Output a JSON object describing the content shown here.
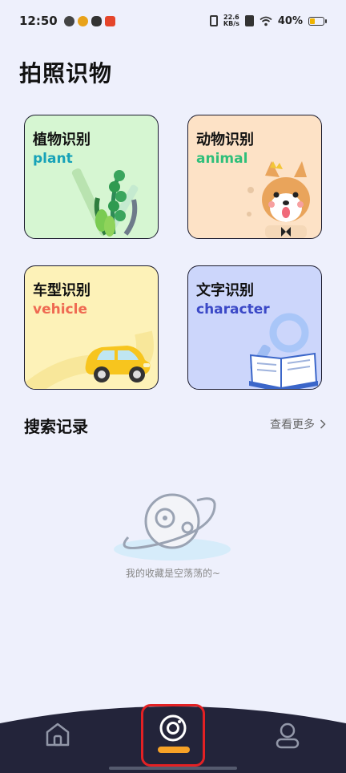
{
  "status_bar": {
    "time": "12:50",
    "net_speed_value": "22.6",
    "net_speed_unit": "KB/s",
    "battery": "40%",
    "battery_level": 0.4
  },
  "page_title": "拍照识物",
  "cards": [
    {
      "zh": "植物识别",
      "en": "plant",
      "en_color": "#17a2b8"
    },
    {
      "zh": "动物识别",
      "en": "animal",
      "en_color": "#2fbf7a"
    },
    {
      "zh": "车型识别",
      "en": "vehicle",
      "en_color": "#ef6a52"
    },
    {
      "zh": "文字识别",
      "en": "character",
      "en_color": "#3b49c7"
    }
  ],
  "history": {
    "title": "搜索记录",
    "more": "查看更多",
    "empty_text": "我的收藏是空荡荡的~"
  },
  "tabs": [
    {
      "name": "home",
      "icon": "home-icon"
    },
    {
      "name": "camera",
      "icon": "camera-icon",
      "active": true
    },
    {
      "name": "user",
      "icon": "user-icon"
    }
  ],
  "colors": {
    "background": "#eef0fc",
    "tabbar": "#23243a",
    "accent": "#f7a227",
    "highlight": "#e32124"
  }
}
